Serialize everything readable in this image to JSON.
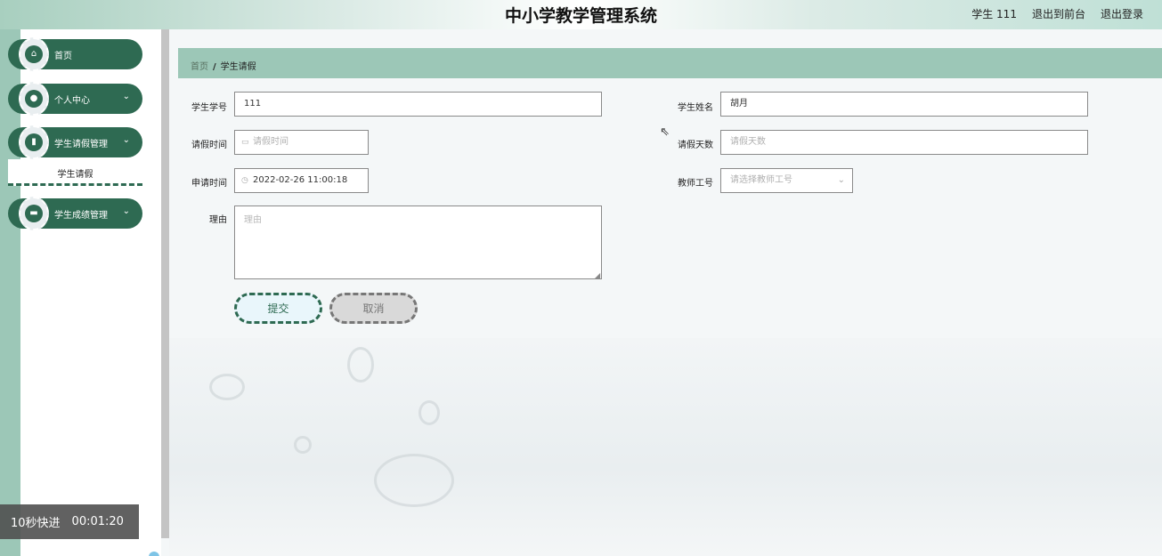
{
  "header": {
    "title": "中小学教学管理系统",
    "user_label": "学生 111",
    "back_to_front": "退出到前台",
    "logout": "退出登录"
  },
  "sidebar": {
    "items": [
      {
        "label": "首页",
        "icon": "home-icon"
      },
      {
        "label": "个人中心",
        "icon": "person-icon"
      },
      {
        "label": "学生请假管理",
        "icon": "bar-chart-icon"
      },
      {
        "label": "学生成绩管理",
        "icon": "ticket-icon"
      }
    ],
    "submenu": {
      "label": "学生请假"
    }
  },
  "breadcrumb": {
    "home": "首页",
    "separator": "/",
    "current": "学生请假"
  },
  "form": {
    "student_id": {
      "label": "学生学号",
      "value": "111"
    },
    "student_name": {
      "label": "学生姓名",
      "value": "胡月"
    },
    "leave_time": {
      "label": "请假时间",
      "placeholder": "请假时间"
    },
    "leave_days": {
      "label": "请假天数",
      "placeholder": "请假天数"
    },
    "apply_time": {
      "label": "申请时间",
      "value": "2022-02-26 11:00:18"
    },
    "teacher_id": {
      "label": "教师工号",
      "placeholder": "请选择教师工号"
    },
    "reason": {
      "label": "理由",
      "placeholder": "理由"
    },
    "submit": "提交",
    "cancel": "取消"
  },
  "overlay": {
    "fast_forward": "10秒快进",
    "time": "00:01:20"
  },
  "colors": {
    "primary": "#2e6a52",
    "accent_light": "#9cc7b7"
  }
}
